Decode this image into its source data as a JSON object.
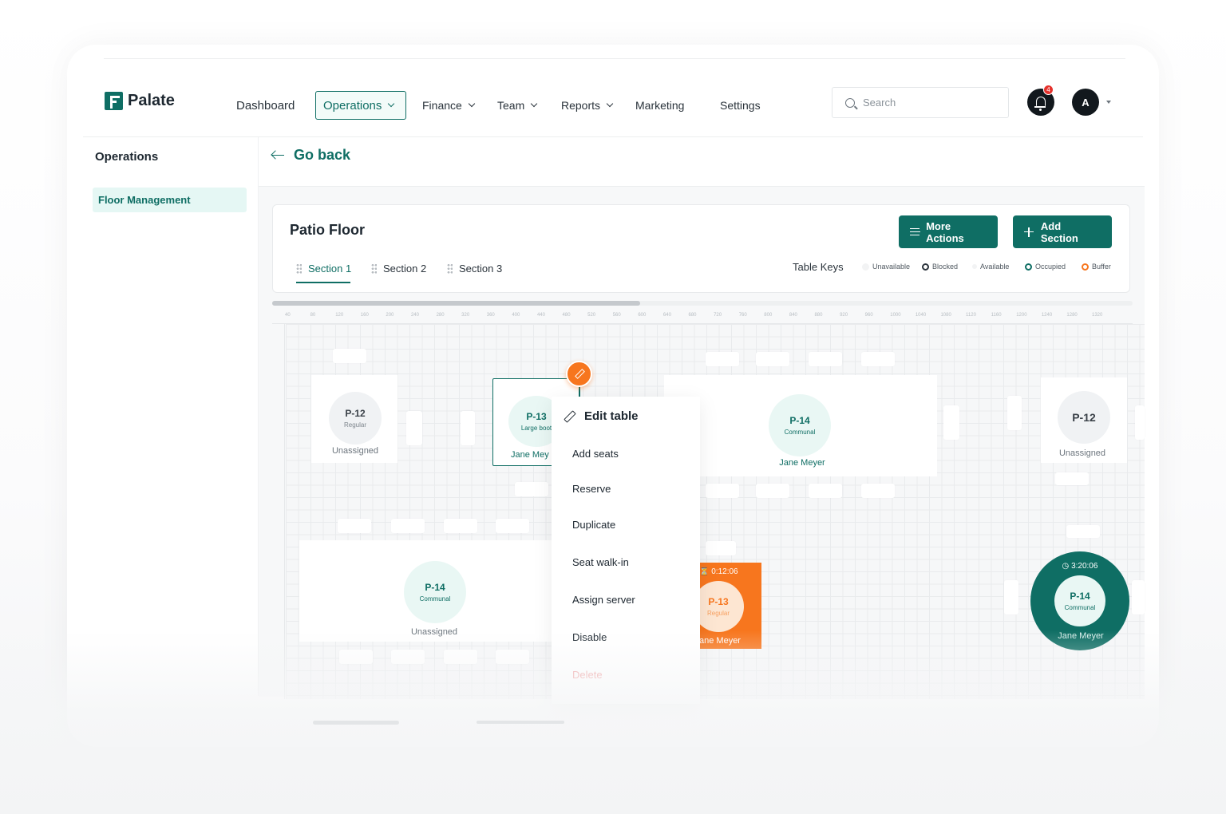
{
  "brand": {
    "name": "Palate",
    "color": "#0f6e64"
  },
  "nav": {
    "dashboard": "Dashboard",
    "operations": "Operations",
    "finance": "Finance",
    "team": "Team",
    "reports": "Reports",
    "marketing": "Marketing",
    "settings": "Settings"
  },
  "search": {
    "placeholder": "Search"
  },
  "notifications": {
    "count": "4"
  },
  "user": {
    "initial": "A"
  },
  "sidebar": {
    "title": "Operations",
    "items": [
      {
        "label": "Floor Management"
      }
    ]
  },
  "page": {
    "back_label": "Go back",
    "floor_title": "Patio Floor"
  },
  "actions": {
    "more": "More Actions",
    "add_section": "Add Section"
  },
  "tabs": [
    {
      "label": "Section 1",
      "active": true
    },
    {
      "label": "Section 2",
      "active": false
    },
    {
      "label": "Section 3",
      "active": false
    }
  ],
  "table_keys": {
    "label": "Table Keys",
    "items": [
      {
        "label": "Unavailable",
        "color": "#e6e8ea"
      },
      {
        "label": "Blocked",
        "color": "#2a333b"
      },
      {
        "label": "Available",
        "color": "#e6e8ea"
      },
      {
        "label": "Occupied",
        "color": "#0f6e64"
      },
      {
        "label": "Buffer",
        "color": "#f7761e"
      }
    ]
  },
  "ruler": [
    "40",
    "80",
    "120",
    "160",
    "200",
    "240",
    "280",
    "320",
    "360",
    "400",
    "440",
    "480",
    "520",
    "560",
    "600",
    "640",
    "680",
    "720",
    "760",
    "800",
    "840",
    "880",
    "920",
    "960",
    "1000",
    "1040",
    "1080",
    "1120",
    "1160",
    "1200",
    "1240",
    "1280",
    "1320"
  ],
  "tables": {
    "t1": {
      "code": "P-12",
      "type": "Regular",
      "status": "Unassigned"
    },
    "t2": {
      "code": "P-13",
      "type": "Large boot",
      "status": "Jane Mey"
    },
    "t3": {
      "code": "P-14",
      "type": "Communal",
      "status": "Jane Meyer"
    },
    "t4": {
      "code": "P-12",
      "type": "",
      "status": "Unassigned"
    },
    "t5": {
      "code": "P-14",
      "type": "Communal",
      "status": "Unassigned"
    },
    "t6": {
      "code": "P-13",
      "type": "Regular",
      "status": "ane Meyer",
      "timer": "0:12:06"
    },
    "t7": {
      "code": "P-14",
      "type": "Communal",
      "status": "Jane Meyer",
      "timer": "3:20:06"
    }
  },
  "context_menu": {
    "title": "Edit table",
    "items": [
      "Add seats",
      "Reserve",
      "Duplicate",
      "Seat walk-in",
      "Assign server",
      "Disable",
      "Delete"
    ]
  },
  "colors": {
    "accent": "#0f6e64",
    "buffer": "#f7761e",
    "danger": "#f0a1a1"
  }
}
